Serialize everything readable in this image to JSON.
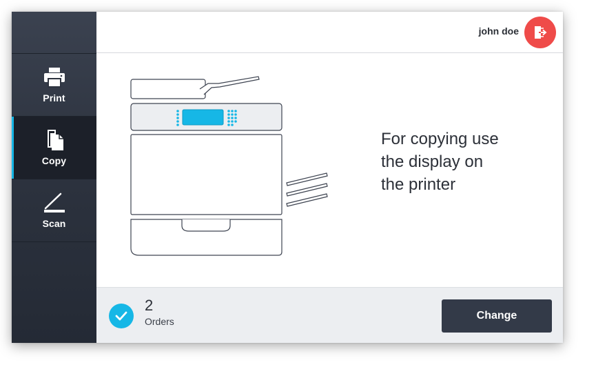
{
  "sidebar": {
    "items": [
      {
        "id": "print",
        "label": "Print",
        "icon": "printer-icon",
        "active": false
      },
      {
        "id": "copy",
        "label": "Copy",
        "icon": "copy-icon",
        "active": true
      },
      {
        "id": "scan",
        "label": "Scan",
        "icon": "scan-icon",
        "active": false
      }
    ]
  },
  "header": {
    "username": "john doe",
    "logout_icon": "logout-icon"
  },
  "main": {
    "illustration": "printer-illustration",
    "message_lines": [
      "For copying use",
      "the display on",
      "the printer"
    ]
  },
  "footer": {
    "orders_count": "2",
    "orders_label": "Orders",
    "change_label": "Change",
    "status_icon": "check-icon"
  },
  "colors": {
    "accent": "#16b7e6",
    "danger": "#ef4b49",
    "sidebar_bg": "#2d333f",
    "button_bg": "#333a48",
    "footer_bg": "#eceef1"
  }
}
